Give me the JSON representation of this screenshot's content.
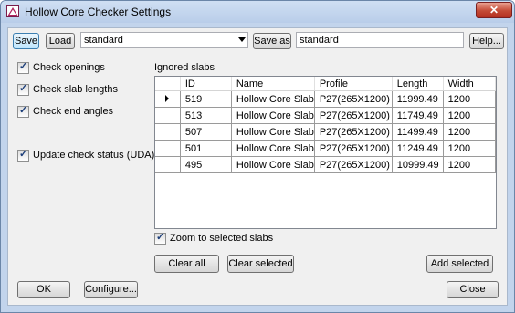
{
  "window": {
    "title": "Hollow Core Checker Settings"
  },
  "toolbar": {
    "save_label": "Save",
    "load_label": "Load",
    "settings_combo_value": "standard",
    "save_as_label": "Save as",
    "save_as_value": "standard",
    "help_label": "Help..."
  },
  "options": {
    "check_openings": {
      "label": "Check openings",
      "checked": true
    },
    "check_slab_lengths": {
      "label": "Check slab lengths",
      "checked": true
    },
    "check_end_angles": {
      "label": "Check end angles",
      "checked": true
    },
    "update_check_status": {
      "label": "Update check status (UDA)",
      "checked": true
    }
  },
  "ignored": {
    "group_label": "Ignored slabs",
    "columns": [
      "ID",
      "Name",
      "Profile",
      "Length",
      "Width"
    ],
    "rows": [
      {
        "id": "519",
        "name": "Hollow Core Slab",
        "profile": "P27(265X1200)",
        "length": "11999.49",
        "width": "1200",
        "current": true
      },
      {
        "id": "513",
        "name": "Hollow Core Slab",
        "profile": "P27(265X1200)",
        "length": "11749.49",
        "width": "1200",
        "current": false
      },
      {
        "id": "507",
        "name": "Hollow Core Slab",
        "profile": "P27(265X1200)",
        "length": "11499.49",
        "width": "1200",
        "current": false
      },
      {
        "id": "501",
        "name": "Hollow Core Slab",
        "profile": "P27(265X1200)",
        "length": "11249.49",
        "width": "1200",
        "current": false
      },
      {
        "id": "495",
        "name": "Hollow Core Slab",
        "profile": "P27(265X1200)",
        "length": "10999.49",
        "width": "1200",
        "current": false
      }
    ],
    "zoom_label": "Zoom to selected slabs",
    "zoom_checked": true,
    "clear_all_label": "Clear all",
    "clear_selected_label": "Clear selected",
    "add_selected_label": "Add selected"
  },
  "footer": {
    "ok_label": "OK",
    "configure_label": "Configure...",
    "close_label": "Close"
  },
  "colors": {
    "accent": "#3c7fb1",
    "close_button": "#c44a35",
    "frame": "#c2d4ec"
  },
  "icons": {
    "app": "hollow-core-app-icon",
    "close": "close-icon",
    "check": "checkmark-icon",
    "dropdown": "chevron-down-icon",
    "row_indicator": "current-row-arrow-icon"
  }
}
